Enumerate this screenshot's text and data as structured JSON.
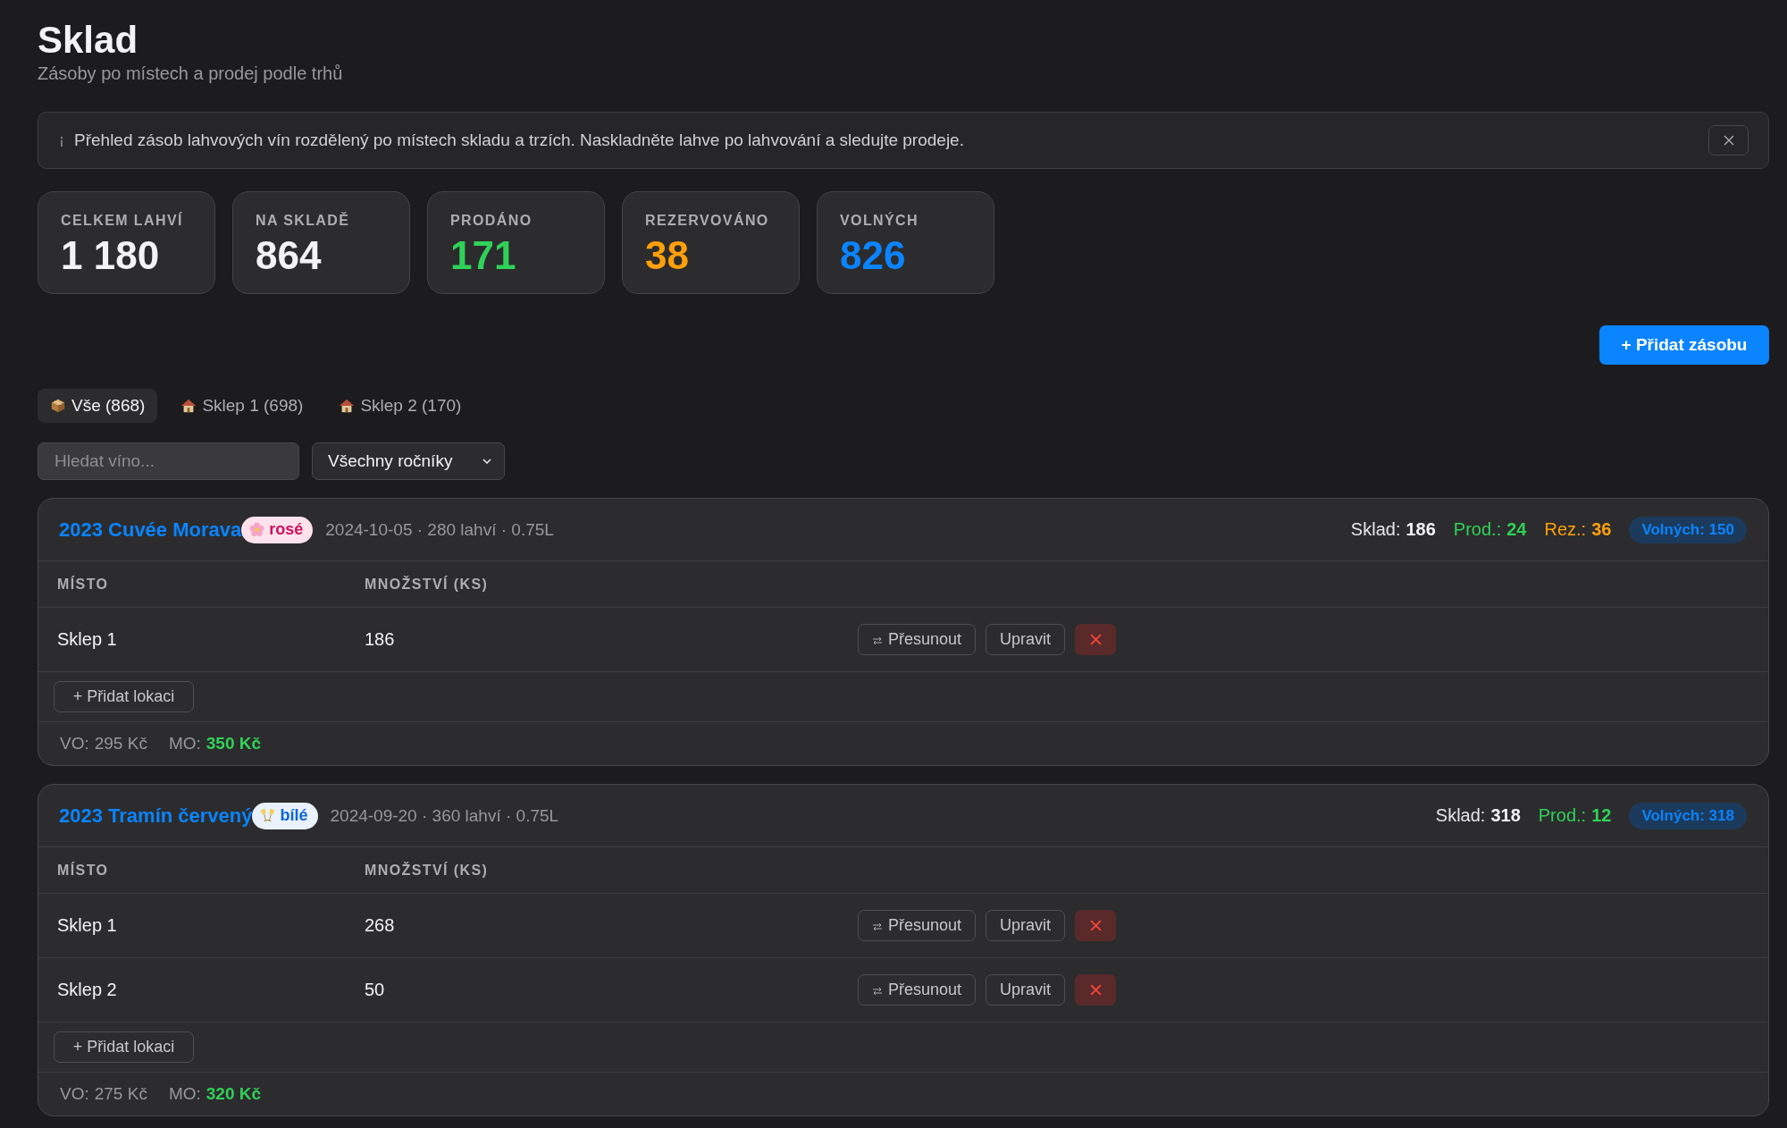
{
  "page": {
    "title": "Sklad",
    "subtitle": "Zásoby po místech a prodej podle trhů"
  },
  "info_banner": {
    "text": "Přehled zásob lahvových vín rozdělený po místech skladu a trzích. Naskladněte lahve po lahvování a sledujte prodeje."
  },
  "stats": [
    {
      "label": "CELKEM LAHVÍ",
      "value": "1 180",
      "color": "#f2f2f7"
    },
    {
      "label": "NA SKLADĚ",
      "value": "864",
      "color": "#f2f2f7"
    },
    {
      "label": "PRODÁNO",
      "value": "171",
      "color": "#30d158"
    },
    {
      "label": "REZERVOVÁNO",
      "value": "38",
      "color": "#ff9f0a"
    },
    {
      "label": "VOLNÝCH",
      "value": "826",
      "color": "#0a84ff"
    }
  ],
  "add_button": {
    "label": "+ Přidat zásobu"
  },
  "tabs": [
    {
      "kind": "all",
      "label": "Vše (868)",
      "selected": true
    },
    {
      "kind": "location",
      "label": "Sklep 1 (698)",
      "selected": false
    },
    {
      "kind": "location",
      "label": "Sklep 2 (170)",
      "selected": false
    }
  ],
  "filters": {
    "search": {
      "placeholder": "Hledat víno..."
    },
    "vintage": {
      "value": "Všechny ročníky"
    }
  },
  "wines": [
    {
      "name": "2023 Cuvée Morava",
      "type": {
        "kind": "rose",
        "label": "rosé"
      },
      "meta": "2024-10-05 · 280 lahví · 0.75L",
      "summary": [
        {
          "kind": "stock",
          "label": "Sklad:",
          "value": "186"
        },
        {
          "kind": "sold",
          "label": "Prod.:",
          "value": "24"
        },
        {
          "kind": "reserved",
          "label": "Rez.:",
          "value": "36"
        }
      ],
      "available": "Volných: 150",
      "columns": [
        "MÍSTO",
        "MNOŽSTVÍ (KS)"
      ],
      "rows": [
        {
          "location": "Sklep 1",
          "quantity": "186",
          "actions": [
            {
              "kind": "move",
              "label": "Přesunout"
            },
            {
              "kind": "edit",
              "label": "Upravit"
            },
            {
              "kind": "delete"
            }
          ]
        }
      ],
      "add_location": "+ Přidat lokaci",
      "prices": [
        {
          "kind": "wholesale",
          "label": "VO:",
          "value": "295 Kč"
        },
        {
          "kind": "retail",
          "label": "MO:",
          "value": "350 Kč"
        }
      ]
    },
    {
      "name": "2023 Tramín červený",
      "type": {
        "kind": "white",
        "label": "bílé"
      },
      "meta": "2024-09-20 · 360 lahví · 0.75L",
      "summary": [
        {
          "kind": "stock",
          "label": "Sklad:",
          "value": "318"
        },
        {
          "kind": "sold",
          "label": "Prod.:",
          "value": "12"
        }
      ],
      "available": "Volných: 318",
      "columns": [
        "MÍSTO",
        "MNOŽSTVÍ (KS)"
      ],
      "rows": [
        {
          "location": "Sklep 1",
          "quantity": "268",
          "actions": [
            {
              "kind": "move",
              "label": "Přesunout"
            },
            {
              "kind": "edit",
              "label": "Upravit"
            },
            {
              "kind": "delete"
            }
          ]
        },
        {
          "location": "Sklep 2",
          "quantity": "50",
          "actions": [
            {
              "kind": "move",
              "label": "Přesunout"
            },
            {
              "kind": "edit",
              "label": "Upravit"
            },
            {
              "kind": "delete"
            }
          ]
        }
      ],
      "add_location": "+ Přidat lokaci",
      "prices": [
        {
          "kind": "wholesale",
          "label": "VO:",
          "value": "275 Kč"
        },
        {
          "kind": "retail",
          "label": "MO:",
          "value": "320 Kč"
        }
      ]
    }
  ]
}
